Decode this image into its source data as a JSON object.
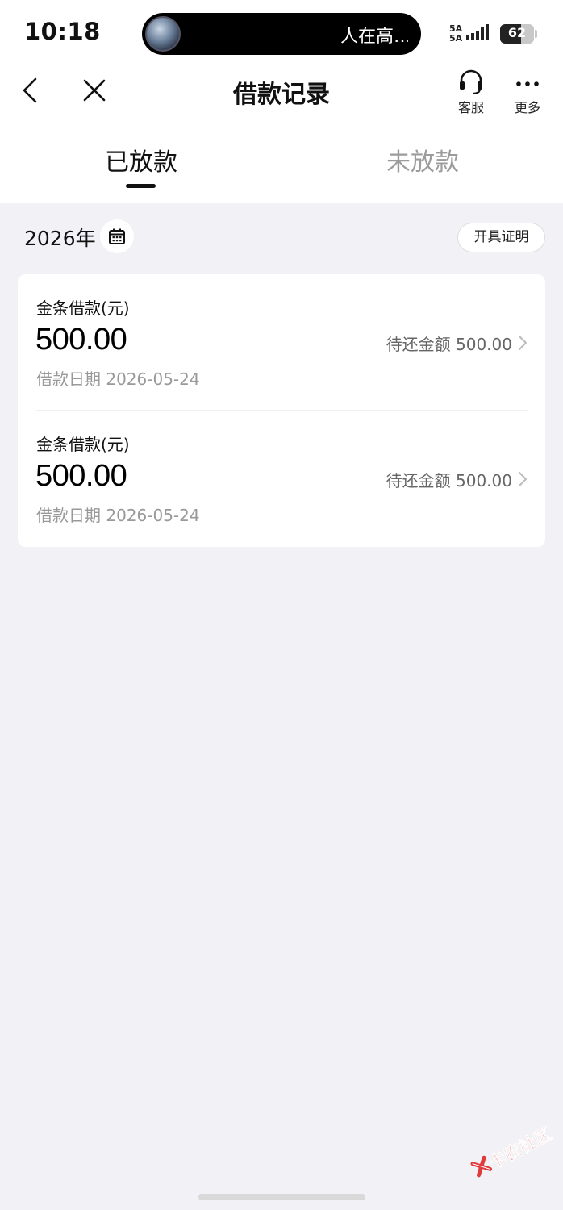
{
  "status_bar": {
    "time": "10:18",
    "island_text": "人在高…",
    "signal_label_1": "5A",
    "signal_label_2": "5A",
    "battery_level": "62",
    "battery_fraction": 0.62
  },
  "nav": {
    "title": "借款记录",
    "back_icon": "chevron-left-icon",
    "close_icon": "close-icon",
    "service_label": "客服",
    "more_label": "更多"
  },
  "tabs": [
    {
      "label": "已放款",
      "active": true
    },
    {
      "label": "未放款",
      "active": false
    }
  ],
  "filter": {
    "year": "2026年",
    "calendar_icon": "calendar-icon",
    "certificate_label": "开具证明"
  },
  "loans": [
    {
      "type": "金条借款(元)",
      "amount": "500.00",
      "date": "借款日期 2026-05-24",
      "due": "待还金额 500.00"
    },
    {
      "type": "金条借款(元)",
      "amount": "500.00",
      "date": "借款日期 2026-05-24",
      "due": "待还金额 500.00"
    }
  ],
  "watermark": {
    "text": "卡农社区",
    "color": "#e03a3a"
  },
  "colors": {
    "page_background": "#f1f1f6",
    "surface": "#ffffff",
    "text_primary": "#111111",
    "text_secondary": "#999999",
    "tab_inactive": "#9b9b9b"
  }
}
